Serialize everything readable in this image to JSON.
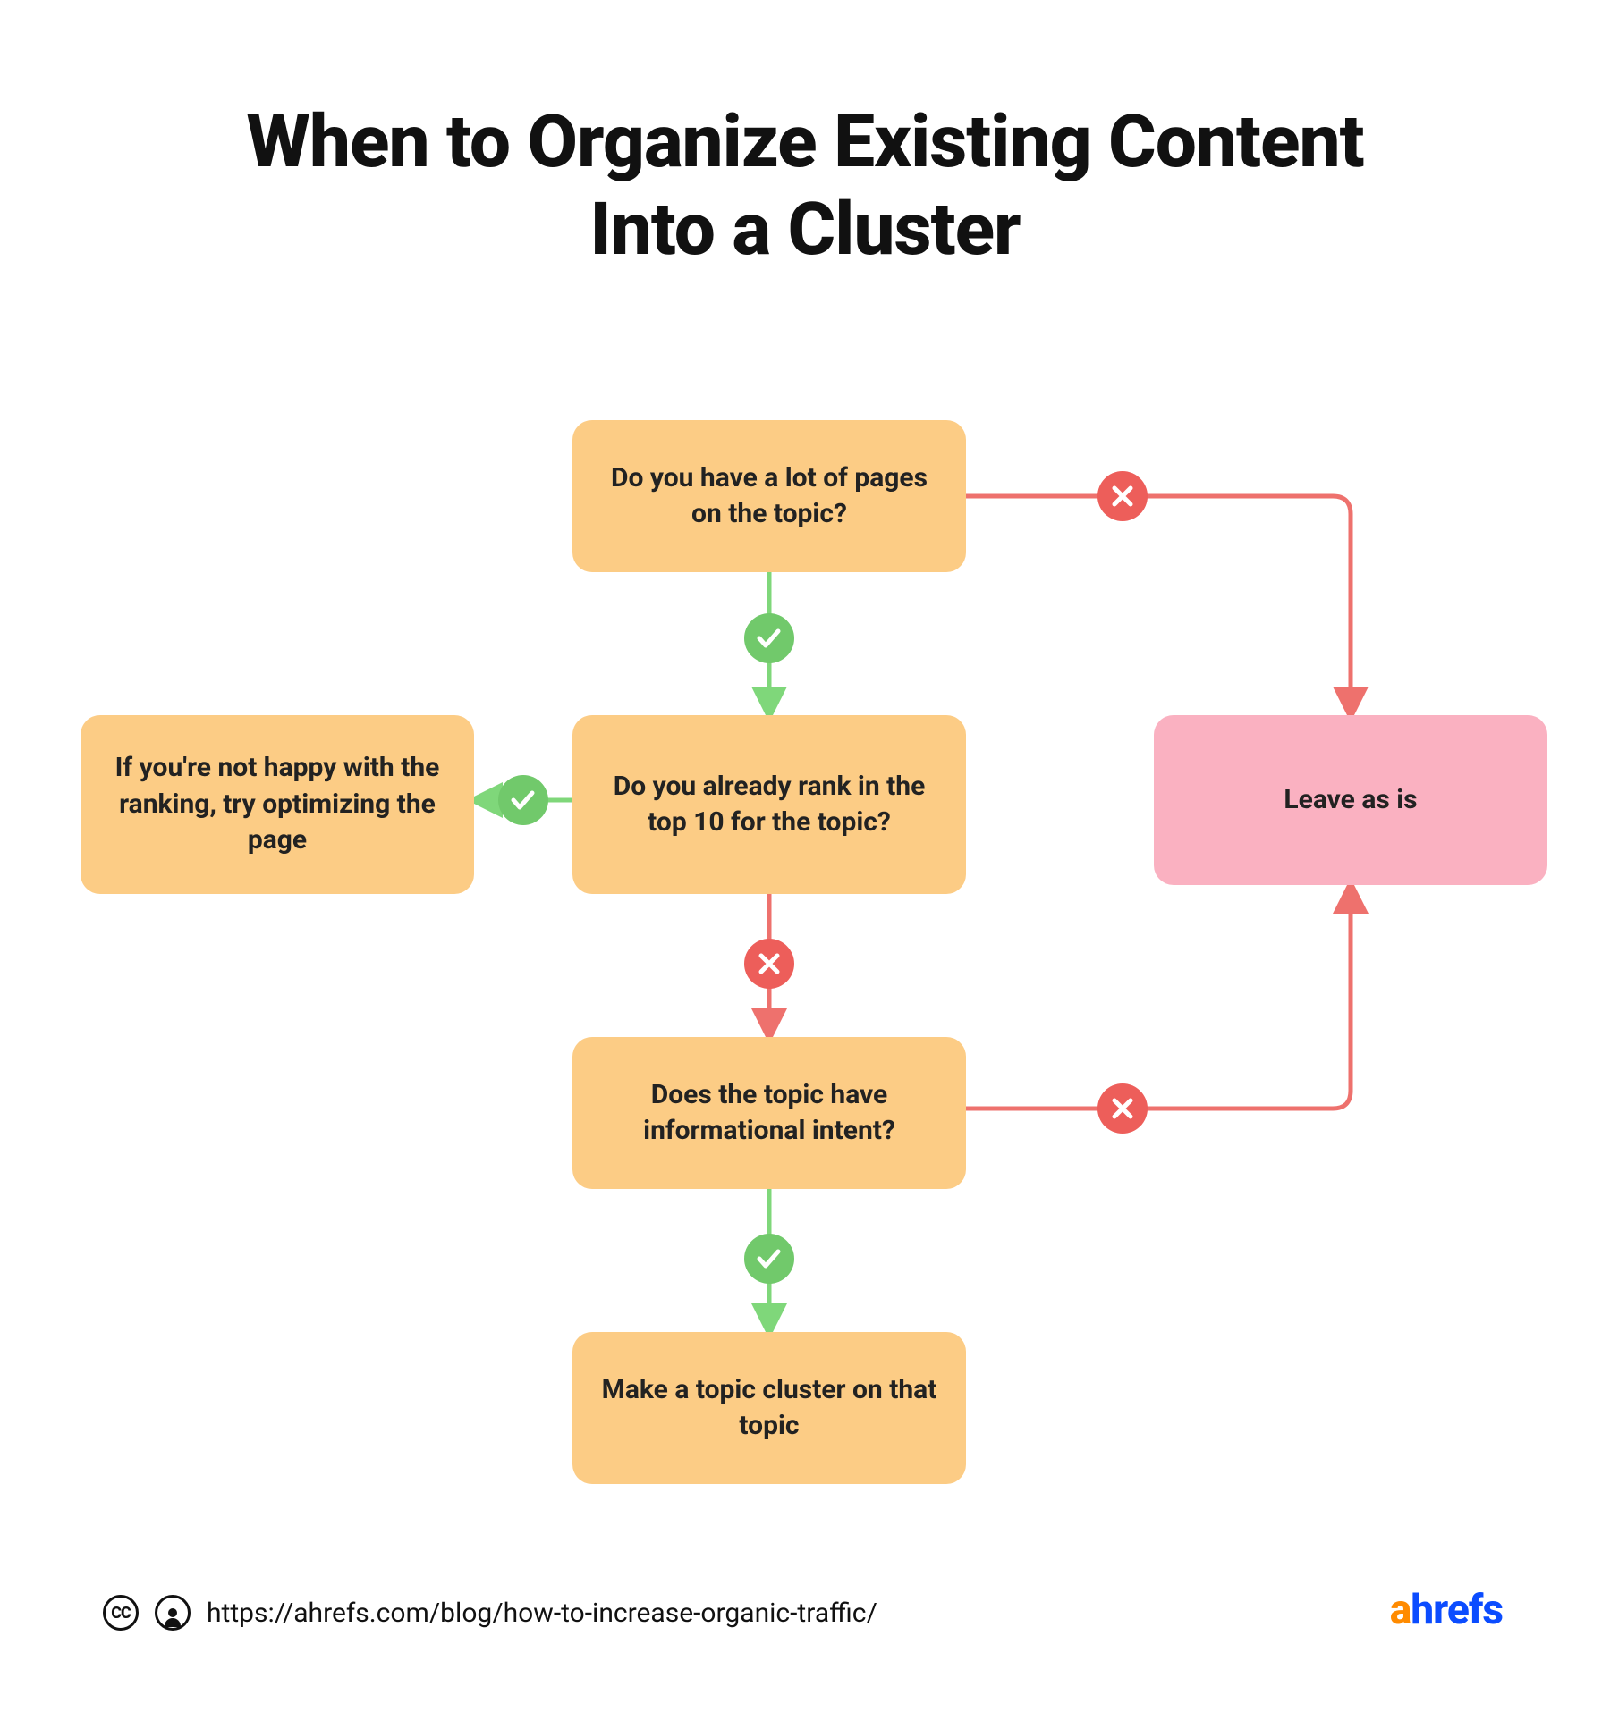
{
  "title": "When to Organize Existing Content Into a Cluster",
  "nodes": {
    "q1": "Do you have a lot of pages on the topic?",
    "q2": "Do you already rank in the top 10 for the topic?",
    "q3": "Does the topic have informational intent?",
    "optimize": "If you're not happy with the ranking, try optimizing the page",
    "leave": "Leave as is",
    "cluster": "Make a topic cluster on that topic"
  },
  "footer": {
    "url": "https://ahrefs.com/blog/how-to-increase-organic-traffic/",
    "cc_label": "CC"
  },
  "brand": {
    "first": "a",
    "rest": "hrefs"
  },
  "colors": {
    "orange_box": "#fccc85",
    "pink_box": "#fab1c1",
    "green": "#71c96b",
    "green_stroke": "#7fd77a",
    "red": "#ed5e5a",
    "red_stroke": "#ee716d"
  }
}
